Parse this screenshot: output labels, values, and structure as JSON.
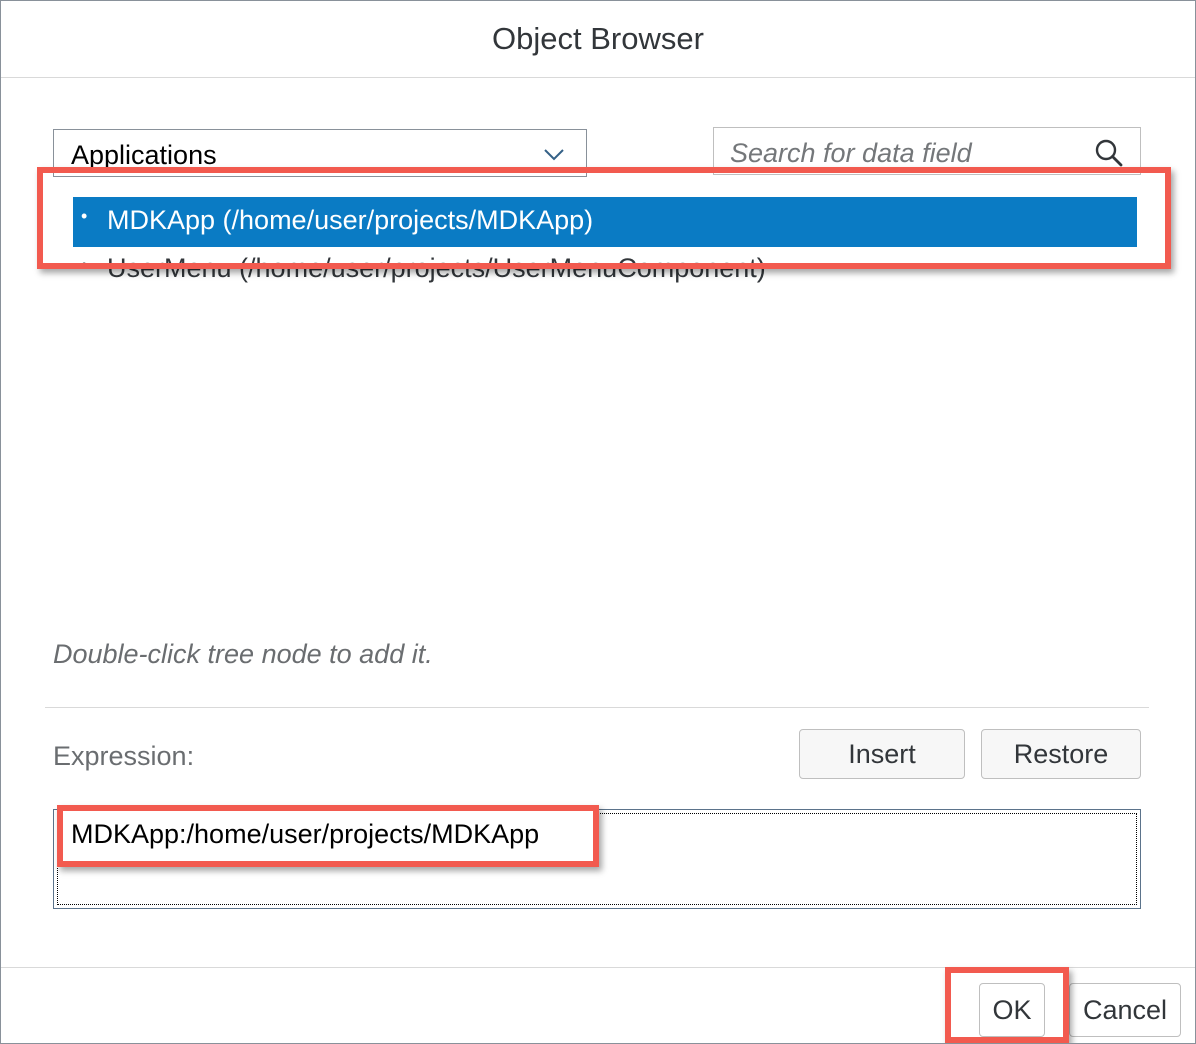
{
  "dialog": {
    "title": "Object Browser"
  },
  "selector": {
    "value": "Applications",
    "icon": "chevron-down-icon"
  },
  "search": {
    "placeholder": "Search for data field",
    "icon": "search-icon"
  },
  "tree": {
    "items": [
      {
        "label": "MDKApp (/home/user/projects/MDKApp)",
        "selected": true
      },
      {
        "label": "UserMenu (/home/user/projects/UserMenuComponent)",
        "selected": false
      }
    ]
  },
  "hint": "Double-click tree node to add it.",
  "expression": {
    "label": "Expression:",
    "value": "MDKApp:/home/user/projects/MDKApp",
    "insert_label": "Insert",
    "restore_label": "Restore"
  },
  "footer": {
    "ok_label": "OK",
    "cancel_label": "Cancel"
  },
  "colors": {
    "selection": "#0a7bc4",
    "highlight": "#f25a4f"
  }
}
